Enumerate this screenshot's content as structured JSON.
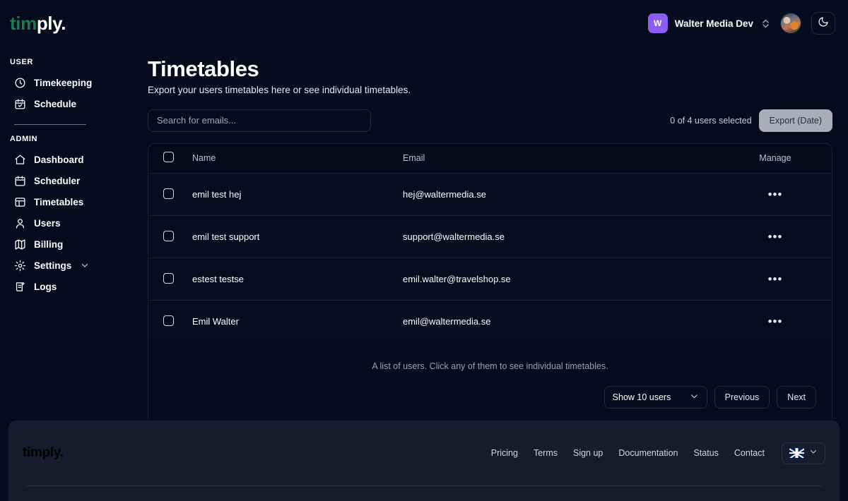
{
  "brand": {
    "logo_prefix": "tim",
    "logo_suffix": "ply.",
    "green": "#1f7a4d",
    "white": "#ffffff"
  },
  "topbar": {
    "org_initial": "W",
    "org_name": "Walter Media Dev",
    "org_badge_color": "#8b5cf6",
    "switcher_icon": "chevron-up-down-icon",
    "avatar_icon": "user-avatar",
    "theme_toggle_icon": "moon-icon"
  },
  "sidebar": {
    "groups": [
      {
        "title": "USER",
        "items": [
          {
            "label": "Timekeeping",
            "icon": "clock-icon"
          },
          {
            "label": "Schedule",
            "icon": "calendar-check-icon"
          }
        ]
      },
      {
        "title": "ADMIN",
        "items": [
          {
            "label": "Dashboard",
            "icon": "home-icon"
          },
          {
            "label": "Scheduler",
            "icon": "calendar-icon"
          },
          {
            "label": "Timetables",
            "icon": "table-icon"
          },
          {
            "label": "Users",
            "icon": "user-icon"
          },
          {
            "label": "Billing",
            "icon": "map-icon"
          },
          {
            "label": "Settings",
            "icon": "gear-icon",
            "chevron": "chevron-down-icon"
          },
          {
            "label": "Logs",
            "icon": "scroll-icon"
          }
        ]
      }
    ]
  },
  "page": {
    "title": "Timetables",
    "subtitle": "Export your users timetables here or see individual timetables."
  },
  "toolbar": {
    "search_placeholder": "Search for emails...",
    "search_value": "",
    "selected_count": "0 of 4 users selected",
    "export_label": "Export (Date)",
    "export_bg": "#a8adb8"
  },
  "table": {
    "columns": [
      "Name",
      "Email",
      "Manage"
    ],
    "header_checkbox": "select-all-checkbox",
    "manage_icon": "ellipsis-icon",
    "rows": [
      {
        "name": "emil test hej",
        "email": "hej@waltermedia.se",
        "manage": "•••",
        "checked": false
      },
      {
        "name": "emil test support",
        "email": "support@waltermedia.se",
        "manage": "•••",
        "checked": false
      },
      {
        "name": "estest testse",
        "email": "emil.walter@travelshop.se",
        "manage": "•••",
        "checked": false
      },
      {
        "name": "Emil Walter",
        "email": "emil@waltermedia.se",
        "manage": "•••",
        "checked": false
      }
    ],
    "caption": "A list of users. Click any of them to see individual timetables."
  },
  "pagination": {
    "page_size_label": "Show 10 users",
    "previous_label": "Previous",
    "next_label": "Next",
    "chevron_icon": "chevron-down-icon"
  },
  "footer": {
    "logo_prefix": "tim",
    "logo_suffix": "ply.",
    "links": [
      "Pricing",
      "Terms",
      "Sign up",
      "Documentation",
      "Status",
      "Contact"
    ],
    "language_icon": "uk-flag-icon",
    "language_chevron": "chevron-down-icon"
  }
}
